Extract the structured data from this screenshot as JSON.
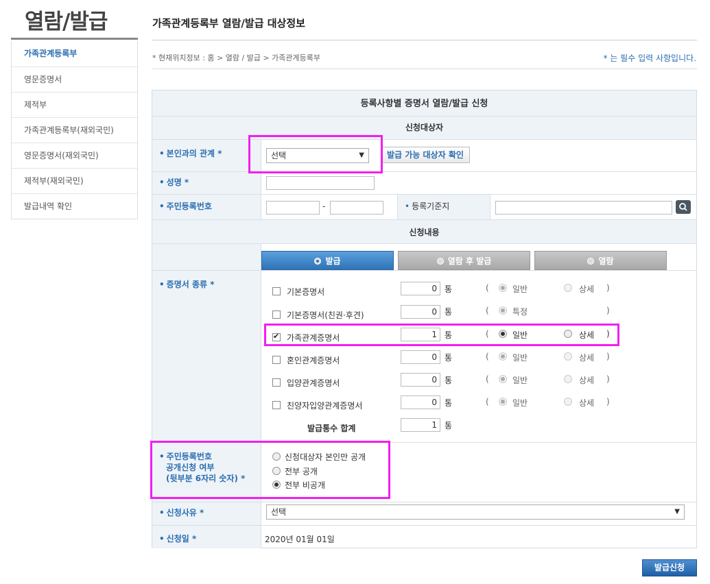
{
  "sidebar": {
    "title": "열람/발급",
    "items": [
      {
        "label": "가족관계등록부"
      },
      {
        "label": "영문증명서"
      },
      {
        "label": "제적부"
      },
      {
        "label": "가족관계등록부(재외국민)"
      },
      {
        "label": "영문증명서(재외국민)"
      },
      {
        "label": "제적부(재외국민)"
      },
      {
        "label": "발급내역 확인"
      }
    ]
  },
  "header": {
    "title": "가족관계등록부 열람/발급 대상정보",
    "breadcrumb": "* 현재위치정보 : 홈 > 열람 / 발급 > 가족관계등록부",
    "required_note": "* 는 필수 입력 사항입니다."
  },
  "form": {
    "title": "등록사항별 증명서 열람/발급 신청",
    "section_target": "신청대상자",
    "section_content": "신청내용",
    "relation": {
      "label": "본인과의 관계 *",
      "selected": "선택",
      "check_button": "발급 가능 대상자 확인"
    },
    "name": {
      "label": "성명 *"
    },
    "rrn": {
      "label": "주민등록번호",
      "dash": "-"
    },
    "base_place": {
      "label": "등록기준지"
    },
    "tabs": [
      {
        "label": "발급"
      },
      {
        "label": "열람 후 발급"
      },
      {
        "label": "열람"
      }
    ],
    "cert_type_label": "증명서 종류 *",
    "unit": "통",
    "paren_open": "(",
    "paren_close": ")",
    "certificates": [
      {
        "name": "기본증명서",
        "count": "0",
        "opt1": "일반",
        "opt2": "상세"
      },
      {
        "name": "기본증명서(친권·후견)",
        "count": "0",
        "opt1": "특정",
        "opt2": ""
      },
      {
        "name": "가족관계증명서",
        "count": "1",
        "opt1": "일반",
        "opt2": "상세"
      },
      {
        "name": "혼인관계증명서",
        "count": "0",
        "opt1": "일반",
        "opt2": "상세"
      },
      {
        "name": "입양관계증명서",
        "count": "0",
        "opt1": "일반",
        "opt2": "상세"
      },
      {
        "name": "친양자입양관계증명서",
        "count": "0",
        "opt1": "일반",
        "opt2": "상세"
      }
    ],
    "total": {
      "label": "발급통수 합계",
      "value": "1"
    },
    "rrn_disclosure": {
      "label_lines": [
        "주민등록번호",
        "공개신청 여부",
        "(뒷부분 6자리 숫자) *"
      ],
      "options": [
        "신청대상자 본인만 공개",
        "전부 공개",
        "전부 비공개"
      ]
    },
    "reason": {
      "label": "신청사유 *",
      "selected": "선택"
    },
    "date": {
      "label": "신청일 *",
      "value": "2020년 01월 01일"
    },
    "submit": "발급신청"
  },
  "colors": {
    "accent": "#2a6eb0",
    "highlight": "#f21ef0",
    "panel_bg": "#eef3f8"
  },
  "icons": {
    "search": "magnifier-icon",
    "dropdown": "triangle-down"
  }
}
